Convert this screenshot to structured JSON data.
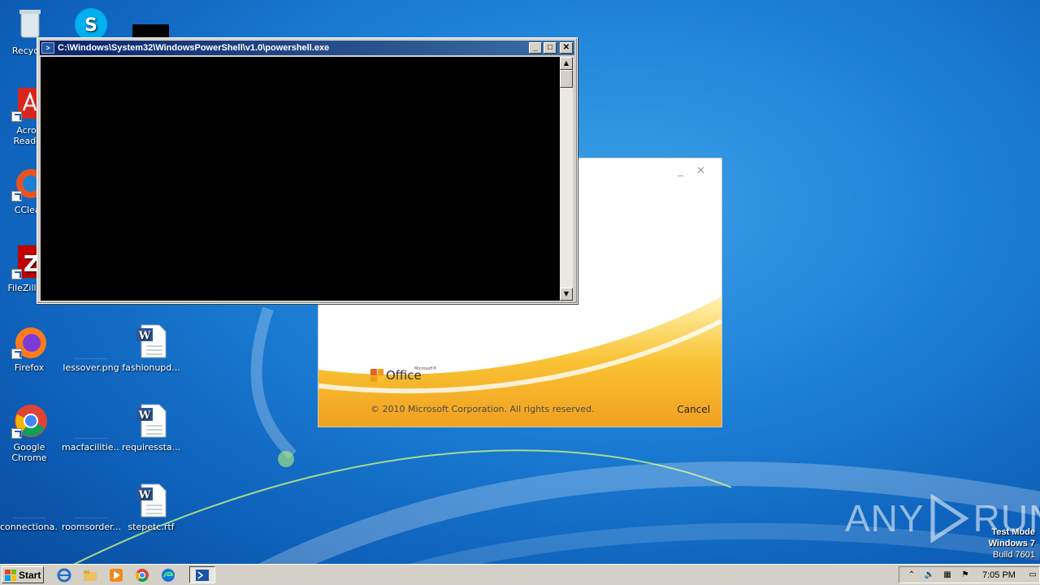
{
  "desktop": {
    "icons": [
      {
        "label": "Recycle"
      },
      {
        "label": "Acrob Reader"
      },
      {
        "label": "CClear"
      },
      {
        "label": "FileZilla C"
      },
      {
        "label": "Firefox"
      },
      {
        "label": "lessover.png"
      },
      {
        "label": "fashionupd..."
      },
      {
        "label": "Google Chrome"
      },
      {
        "label": "macfacilitie..."
      },
      {
        "label": "requiressta..."
      },
      {
        "label": "connectiona..."
      },
      {
        "label": "roomsorder...."
      },
      {
        "label": "stepetc.rtf"
      }
    ]
  },
  "powershell": {
    "title": "C:\\Windows\\System32\\WindowsPowerShell\\v1.0\\powershell.exe",
    "minimize_label": "_",
    "maximize_label": "□",
    "close_label": "✕"
  },
  "office_splash": {
    "logo_text": "Office",
    "logo_superscript": "Microsoft®",
    "copyright": "© 2010 Microsoft Corporation.  All rights reserved.",
    "cancel_label": "Cancel",
    "window_controls": "_ ✕"
  },
  "watermark": {
    "left_text": "ANY",
    "right_text": "RUN"
  },
  "test_mode": {
    "line1": "Test Mode",
    "line2": "Windows 7",
    "line3": "Build 7601"
  },
  "taskbar": {
    "start_label": "Start",
    "clock": "7:05 PM"
  },
  "colors": {
    "desktop_blue": "#1c7fd6",
    "console_black": "#000000",
    "titlebar_blue": "#0a246a",
    "office_orange": "#f5a623"
  }
}
